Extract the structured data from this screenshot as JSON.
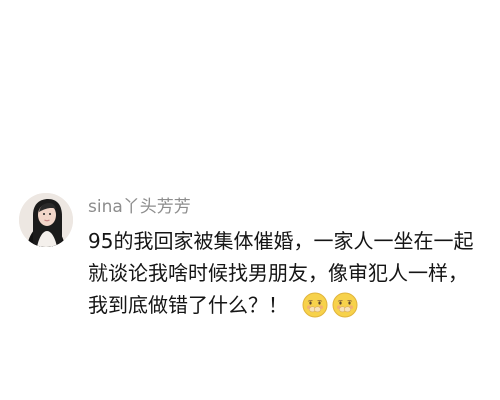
{
  "comment": {
    "username": "sina丫头芳芳",
    "lines": [
      "95的我回家被集体催婚，一家人一坐在一起",
      "就谈论我啥时候找男朋友，像审犯人一样，",
      "我到底做错了什么？！"
    ],
    "emojis": [
      "covering-mouth-emoji",
      "covering-mouth-emoji"
    ]
  }
}
